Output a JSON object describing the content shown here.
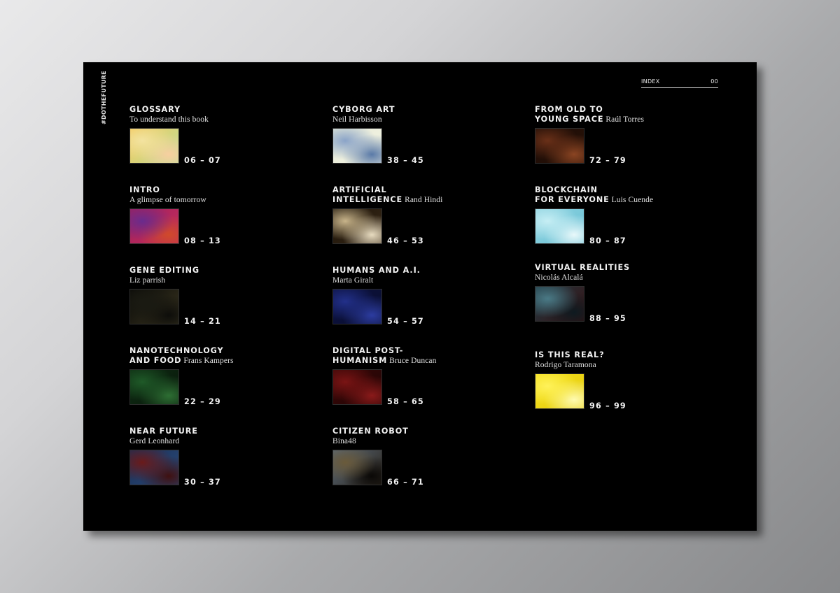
{
  "side_tag": "#DOTHEFUTURE",
  "header": {
    "label": "INDEX",
    "page": "00"
  },
  "entries": [
    {
      "title_line1": "GLOSSARY",
      "title_line2": "",
      "author": "",
      "subtitle": "To understand this book",
      "pages": "06 – 07",
      "thumb_colors": [
        "#f6c85a",
        "#f3e3a0",
        "#b9df9b",
        "#f7cfa0"
      ]
    },
    {
      "title_line1": "INTRO",
      "title_line2": "",
      "author": "",
      "subtitle": "A glimpse of tomorrow",
      "pages": "08 – 13",
      "thumb_colors": [
        "#a0205a",
        "#6a2b8c",
        "#c42d5f",
        "#d04a2a"
      ]
    },
    {
      "title_line1": "GENE EDITING",
      "title_line2": "",
      "author": "",
      "subtitle": "Liz parrish",
      "pages": "14 – 21",
      "thumb_colors": [
        "#0a0a08",
        "#1a1a12",
        "#3a3520",
        "#0d0d0a"
      ]
    },
    {
      "title_line1": "NANOTECHNOLOGY",
      "title_line2": "AND FOOD",
      "author": "Frans Kampers",
      "subtitle": "",
      "pages": "22 – 29",
      "thumb_colors": [
        "#0d2a12",
        "#1f5a28",
        "#0a1a0c",
        "#2d6e33"
      ]
    },
    {
      "title_line1": "NEAR FUTURE",
      "title_line2": "",
      "author": "",
      "subtitle": "Gerd Leonhard",
      "pages": "30 – 37",
      "thumb_colors": [
        "#1a2f55",
        "#6a1a1a",
        "#2a4a7a",
        "#401010"
      ]
    },
    {
      "title_line1": "CYBORG ART",
      "title_line2": "",
      "author": "",
      "subtitle": "Neil Harbisson",
      "pages": "38 – 45",
      "thumb_colors": [
        "#e8ecd8",
        "#8aa3c8",
        "#f2f2e2",
        "#5a7aa8"
      ]
    },
    {
      "title_line1": "ARTIFICIAL",
      "title_line2": "INTELLIGENCE",
      "author": "Rand Hindi",
      "subtitle": "",
      "pages": "46 – 53",
      "thumb_colors": [
        "#1a1208",
        "#c8b48a",
        "#3a2a18",
        "#e8dcc0"
      ]
    },
    {
      "title_line1": "HUMANS AND A.I.",
      "title_line2": "",
      "author": "",
      "subtitle": "Marta Giralt",
      "pages": "54 – 57",
      "thumb_colors": [
        "#0c1240",
        "#22308a",
        "#0a0e2e",
        "#2c3ca0"
      ]
    },
    {
      "title_line1": "DIGITAL POST-",
      "title_line2": "HUMANISM",
      "author": "Bruce Duncan",
      "subtitle": "",
      "pages": "58 – 65",
      "thumb_colors": [
        "#3a0808",
        "#7a1414",
        "#200404",
        "#8a1a1a"
      ]
    },
    {
      "title_line1": "CITIZEN ROBOT",
      "title_line2": "",
      "author": "",
      "subtitle": "Bina48",
      "pages": "66 – 71",
      "thumb_colors": [
        "#5a6a7a",
        "#6a5a3a",
        "#2a2218",
        "#0a0806"
      ]
    },
    {
      "title_line1": "FROM OLD TO",
      "title_line2": "YOUNG SPACE",
      "author": "Raúl Torres",
      "subtitle": "",
      "pages": "72 – 79",
      "thumb_colors": [
        "#1a0c06",
        "#6a3018",
        "#2a1208",
        "#8a4422"
      ]
    },
    {
      "title_line1": "BLOCKCHAIN",
      "title_line2": "FOR EVERYONE",
      "author": "Luis Cuende",
      "subtitle": "",
      "pages": "80 – 87",
      "thumb_colors": [
        "#8fd3e0",
        "#c6eef4",
        "#6cc2d6",
        "#e8f8fa"
      ]
    },
    {
      "title_line1": "VIRTUAL REALITIES",
      "title_line2": "",
      "author": "",
      "subtitle": "Nicolás Alcalá",
      "pages": "88 – 95",
      "thumb_colors": [
        "#1e3a44",
        "#4a7a86",
        "#3a1010",
        "#0e1a20"
      ]
    },
    {
      "title_line1": "IS THIS REAL?",
      "title_line2": "",
      "author": "",
      "subtitle": "Rodrigo Taramona",
      "pages": "96 – 99",
      "thumb_colors": [
        "#f4e01a",
        "#fff25a",
        "#e6cc10",
        "#fffbb0"
      ]
    }
  ]
}
